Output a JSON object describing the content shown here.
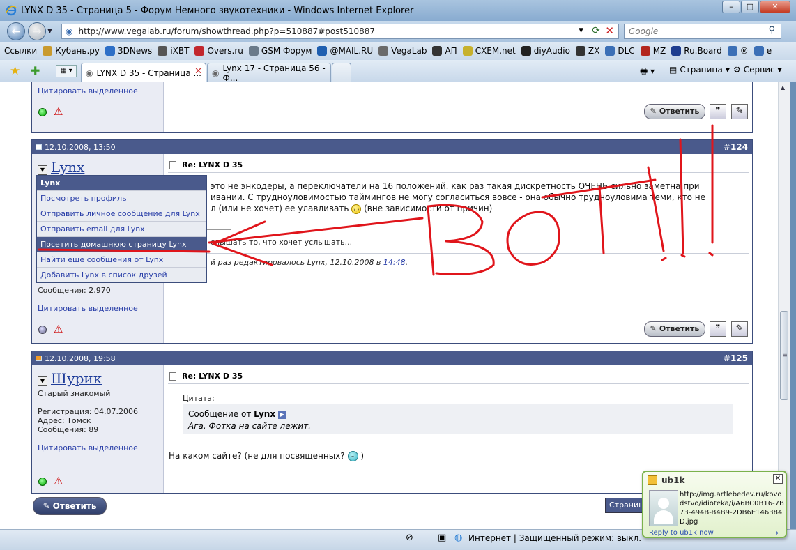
{
  "window": {
    "title": "LYNX D 35 - Страница 5 - Форум Немного звукотехники - Windows Internet Explorer",
    "minimize": "–",
    "maximize": "□",
    "close": "✕"
  },
  "address_bar": {
    "url": "http://www.vegalab.ru/forum/showthread.php?p=510887#post510887",
    "search_placeholder": "Google"
  },
  "links_bar": {
    "label": "Ссылки",
    "items": [
      {
        "label": "Кубань.ру",
        "color": "#c99a2e"
      },
      {
        "label": "3DNews",
        "color": "#2d6fc7"
      },
      {
        "label": "iXBT",
        "color": "#555555"
      },
      {
        "label": "Overs.ru",
        "color": "#c2272d"
      },
      {
        "label": "GSM Форум",
        "color": "#6a7a8a"
      },
      {
        "label": "@MAIL.RU",
        "color": "#1f5fb0"
      },
      {
        "label": "VegaLab",
        "color": "#6a6a6a"
      },
      {
        "label": "АП",
        "color": "#333333"
      },
      {
        "label": "CXEM.net",
        "color": "#c7b12d"
      },
      {
        "label": "diyAudio",
        "color": "#222222"
      },
      {
        "label": "ZX",
        "color": "#333333"
      },
      {
        "label": "DLC",
        "color": "#3b6fb6"
      },
      {
        "label": "MZ",
        "color": "#b3261e"
      },
      {
        "label": "Ru.Board",
        "color": "#1e3d8f"
      },
      {
        "label": "®",
        "color": "#3b6fb6"
      },
      {
        "label": "е",
        "color": "#3b6fb6"
      }
    ]
  },
  "tabs": {
    "active": "LYNX D 35 - Страница ...",
    "inactive": "Lynx 17 - Страница 56 - Ф...",
    "page_menu": "Страница",
    "tools_menu": "Сервис"
  },
  "top_post_tail": {
    "quote_selected": "Цитировать выделенное",
    "reply": "Ответить"
  },
  "post124": {
    "date": "12.10.2008, 13:50",
    "number_prefix": "#",
    "number": "124",
    "username": "Lynx",
    "messages": "Сообщения: 2,970",
    "quote_selected": "Цитировать выделенное",
    "title": "Re: LYNX D 35",
    "line1": "это не энкодеры, а переключатели на 16 положений. как раз такая дискретность ОЧЕНЬ сильно заметна при",
    "line2a": "ивании. С трудноуловимостью таймингов не могу согласиться вовсе - она обычно трудноуловима теми, кто не",
    "line3": "л (или не хочет) ее улавливать",
    "line3b": "(вне зависимости от причин)",
    "signature": "слышать то, что хочет услышать...",
    "edited_prefix": "й раз редактировалось Lynx, 12.10.2008 в",
    "edited_time": "14:48",
    "reply": "Ответить"
  },
  "user_menu": {
    "header": "Lynx",
    "items": [
      "Посмотреть профиль",
      "Отправить личное сообщение для Lynx",
      "Отправить email для Lynx",
      "Посетить домашнюю страницу Lynx",
      "Найти еще сообщения от Lynx",
      "Добавить Lynx в список друзей"
    ]
  },
  "post125": {
    "date": "12.10.2008, 19:58",
    "number_prefix": "#",
    "number": "125",
    "username": "Шурик",
    "user_title": "Старый знакомый",
    "registration": "Регистрация: 04.07.2006",
    "address": "Адрес: Томск",
    "messages": "Сообщения: 89",
    "quote_selected": "Цитировать выделенное",
    "title": "Re: LYNX D 35",
    "quote_label": "Цитата:",
    "quote_from": "Сообщение от",
    "quote_author": "Lynx",
    "quote_text": "Ага. Фотка на сайте лежит.",
    "body": "На каком сайте? (не для посвященных?",
    "body_end": ")"
  },
  "bottom": {
    "reply": "Ответить",
    "pages": "Страниц"
  },
  "annotation": {
    "text": "ВОТ!!!",
    "color": "#e0151b"
  },
  "status_bar": {
    "zone": "Интернет | Защищенный режим: выкл."
  },
  "notification": {
    "sender": "ub1k",
    "message": "http://img.artlebedev.ru/kovodstvo/idioteka/i/A6BC0B16-7B73-494B-B4B9-2DB6E146384D.jpg",
    "reply_link": "Reply to ub1k now"
  }
}
